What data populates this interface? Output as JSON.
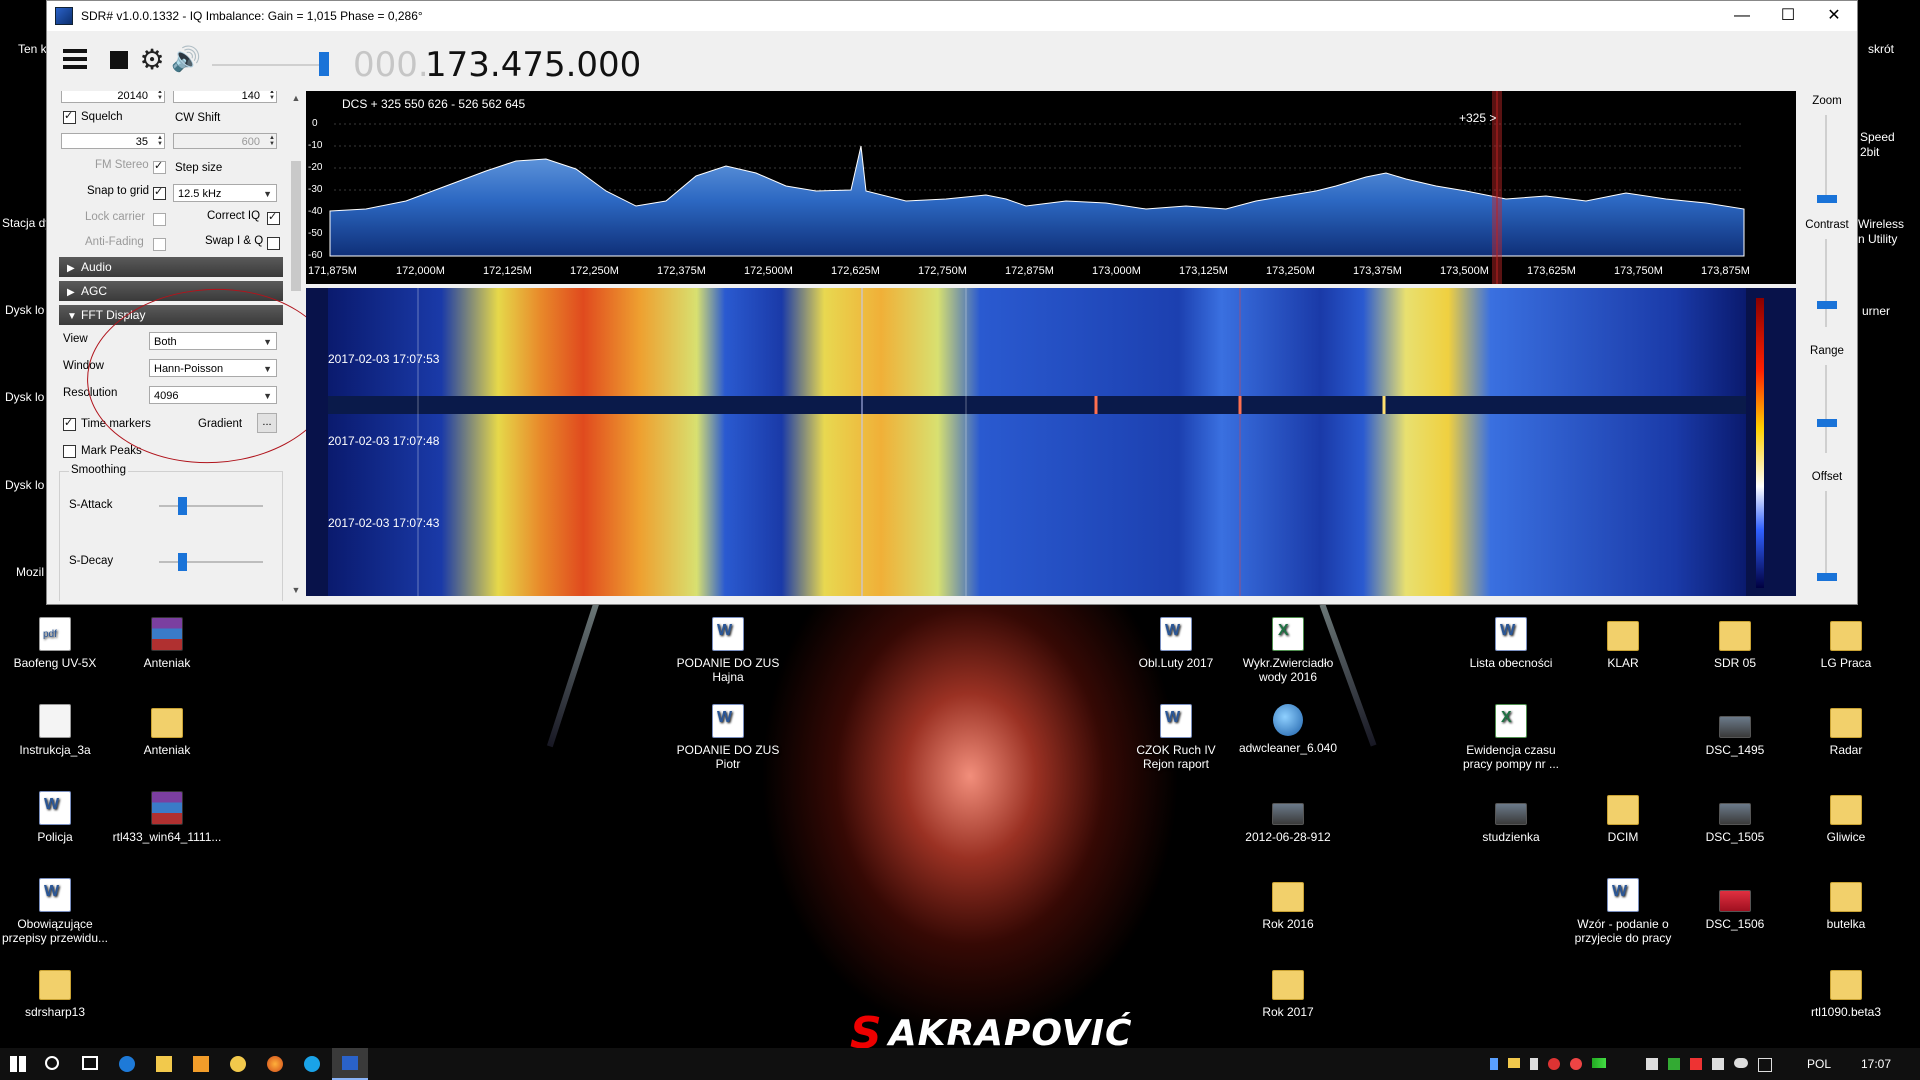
{
  "window": {
    "title": "SDR# v1.0.0.1332 - IQ Imbalance: Gain = 1,015 Phase = 0,286°",
    "minimize": "—",
    "maximize": "☐",
    "close": "✕"
  },
  "toolbar": {
    "freq_dim": "000.",
    "freq_main": "173.475.000"
  },
  "left_panel": {
    "top_value_1": "20140",
    "top_value_2": "140",
    "squelch_label": "Squelch",
    "squelch_value": "35",
    "cw_shift_label": "CW Shift",
    "cw_shift_value": "600",
    "fm_stereo_label": "FM Stereo",
    "step_size_label": "Step size",
    "snap_to_grid_label": "Snap to grid",
    "step_size_value": "12.5 kHz",
    "lock_carrier_label": "Lock carrier",
    "correct_iq_label": "Correct IQ",
    "anti_fading_label": "Anti-Fading",
    "swap_iq_label": "Swap I & Q",
    "audio_section": "Audio",
    "agc_section": "AGC",
    "fft_display_section": "FFT Display",
    "view_label": "View",
    "view_value": "Both",
    "window_label": "Window",
    "window_value": "Hann-Poisson",
    "resolution_label": "Resolution",
    "resolution_value": "4096",
    "time_markers_label": "Time markers",
    "gradient_label": "Gradient",
    "gradient_button": "...",
    "mark_peaks_label": "Mark Peaks",
    "smoothing_label": "Smoothing",
    "s_attack_label": "S-Attack",
    "s_decay_label": "S-Decay"
  },
  "spectrum": {
    "info_text": "DCS + 325 550 626  - 526 562 645",
    "marker_text": "+325 >",
    "y_ticks": [
      "0",
      "-10",
      "-20",
      "-30",
      "-40",
      "-50",
      "-60"
    ],
    "x_ticks": [
      "171,875M",
      "172,000M",
      "172,125M",
      "172,250M",
      "172,375M",
      "172,500M",
      "172,625M",
      "172,750M",
      "172,875M",
      "173,000M",
      "173,125M",
      "173,250M",
      "173,375M",
      "173,500M",
      "173,625M",
      "173,750M",
      "173,875M"
    ]
  },
  "waterfall": {
    "timestamps": [
      "2017-02-03 17:07:53",
      "2017-02-03 17:07:48",
      "2017-02-03 17:07:43"
    ]
  },
  "right_controls": {
    "zoom_label": "Zoom",
    "contrast_label": "Contrast",
    "range_label": "Range",
    "offset_label": "Offset"
  },
  "desktop": {
    "icons": [
      {
        "label": "Baofeng UV-5X",
        "icon": "pdf-file-icon"
      },
      {
        "label": "Anteniak",
        "icon": "rar-archive-icon"
      },
      {
        "label": "PODANIE DO ZUS Hajna",
        "icon": "word-document-icon"
      },
      {
        "label": "Obl.Luty 2017",
        "icon": "word-document-icon"
      },
      {
        "label": "Wykr.Zwierciadło wody 2016",
        "icon": "excel-document-icon"
      },
      {
        "label": "Lista obecności",
        "icon": "word-document-icon"
      },
      {
        "label": "KLAR",
        "icon": "folder-icon"
      },
      {
        "label": "SDR 05",
        "icon": "folder-icon"
      },
      {
        "label": "LG Praca",
        "icon": "folder-icon"
      },
      {
        "label": "Instrukcja_3a",
        "icon": "text-file-icon"
      },
      {
        "label": "Anteniak",
        "icon": "folder-icon"
      },
      {
        "label": "PODANIE DO ZUS Piotr",
        "icon": "word-document-icon"
      },
      {
        "label": "CZOK  Ruch IV Rejon raport",
        "icon": "word-document-icon"
      },
      {
        "label": "adwcleaner_6.040",
        "icon": "globe-icon"
      },
      {
        "label": "Ewidencja czasu pracy pompy nr ...",
        "icon": "excel-document-icon"
      },
      {
        "label": "DSC_1495",
        "icon": "photo-icon"
      },
      {
        "label": "Radar",
        "icon": "folder-icon"
      },
      {
        "label": "Policja",
        "icon": "word-document-icon"
      },
      {
        "label": "rtl433_win64_1111...",
        "icon": "rar-archive-icon"
      },
      {
        "label": "2012-06-28-912",
        "icon": "photo-icon"
      },
      {
        "label": "studzienka",
        "icon": "photo-icon"
      },
      {
        "label": "DCIM",
        "icon": "folder-icon"
      },
      {
        "label": "DSC_1505",
        "icon": "photo-icon"
      },
      {
        "label": "Gliwice",
        "icon": "folder-icon"
      },
      {
        "label": "Obowiązujące przepisy przewidu...",
        "icon": "word-document-icon"
      },
      {
        "label": "Rok 2016",
        "icon": "folder-icon"
      },
      {
        "label": "Wzór - podanie o przyjecie do pracy",
        "icon": "word-document-icon"
      },
      {
        "label": "DSC_1506",
        "icon": "photo-icon"
      },
      {
        "label": "butelka",
        "icon": "folder-icon"
      },
      {
        "label": "sdrsharp13",
        "icon": "folder-icon"
      },
      {
        "label": "Rok 2017",
        "icon": "folder-icon"
      },
      {
        "label": "rtl1090.beta3",
        "icon": "folder-icon"
      }
    ],
    "partial_left": [
      "Ten k",
      "Stacja dy",
      "Dysk lo",
      "Dysk lo",
      "Dysk lo",
      "Mozil"
    ],
    "partial_right": [
      "skrót",
      "Speed",
      "2bit",
      "Wireless",
      "n Utility",
      "urner"
    ],
    "logo_text": "AKRAPOVIĆ"
  },
  "taskbar": {
    "language": "POL",
    "clock": "17:07"
  }
}
